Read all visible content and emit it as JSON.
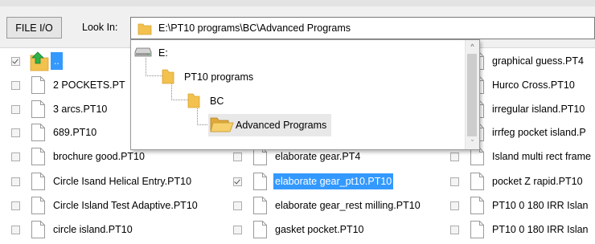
{
  "toolbar": {
    "file_io_label": "FILE I/O",
    "look_in_label": "Look In:",
    "path_value": "E:\\PT10 programs\\BC\\Advanced Programs"
  },
  "dropdown": {
    "items": [
      {
        "label": "E:",
        "icon": "drive-icon"
      },
      {
        "label": "PT10 programs",
        "icon": "folder-icon"
      },
      {
        "label": "BC",
        "icon": "folder-icon"
      },
      {
        "label": "Advanced Programs",
        "icon": "open-folder-icon",
        "selected": true
      }
    ]
  },
  "files": {
    "up_folder_label": "..",
    "col1": [
      "2 POCKETS.PT",
      "3 arcs.PT10",
      "689.PT10",
      "brochure good.PT10",
      "Circle Isand Helical Entry.PT10",
      "Circle Island Test Adaptive.PT10",
      "circle island.PT10"
    ],
    "col2": [
      "elaborate gear.PT4",
      "elaborate gear_pt10.PT10",
      "elaborate gear_rest milling.PT10",
      "gasket pocket.PT10"
    ],
    "col3": [
      "graphical guess.PT4",
      "Hurco Cross.PT10",
      "irregular island.PT10",
      "irrfeg pocket island.P",
      "Island multi rect frame",
      "pocket Z rapid.PT10",
      "PT10 0 180 IRR Islan",
      "PT10 0 180 IRR Islan"
    ],
    "selected_file": "elaborate gear_pt10.PT10"
  },
  "colors": {
    "selection": "#3399ff",
    "folder": "#f2c14e"
  }
}
